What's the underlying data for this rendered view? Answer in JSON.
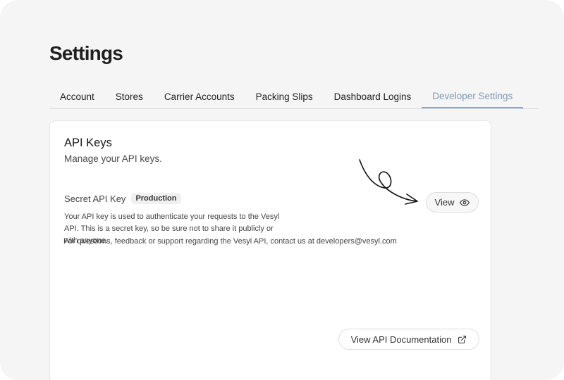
{
  "page": {
    "title": "Settings"
  },
  "tabs": [
    {
      "label": "Account"
    },
    {
      "label": "Stores"
    },
    {
      "label": "Carrier Accounts"
    },
    {
      "label": "Packing Slips"
    },
    {
      "label": "Dashboard Logins"
    },
    {
      "label": "Developer Settings",
      "active": true
    }
  ],
  "api_keys": {
    "title": "API Keys",
    "subtitle": "Manage your API keys.",
    "secret_key_label": "Secret API Key",
    "environment_badge": "Production",
    "description": "Your API key is used to authenticate your requests to the Vesyl API. This is a secret key, so be sure not to share it publicly or with anyone.",
    "view_button_label": "View",
    "view_button_icon": "eye-icon",
    "docs_button_label": "View API Documentation",
    "docs_button_icon": "external-link-icon",
    "footer_note": "For questions, feedback or support regarding the Vesyl API, contact us at developers@vesyl.com"
  },
  "colors": {
    "active_tab": "#7d9ab6",
    "background": "#f5f5f5",
    "card": "#ffffff"
  }
}
